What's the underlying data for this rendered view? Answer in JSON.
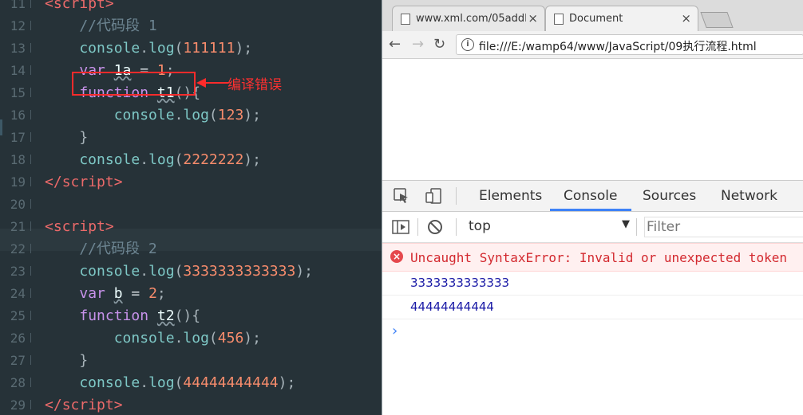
{
  "editor": {
    "lines": [
      {
        "n": "11",
        "tokens": [
          {
            "t": "<",
            "c": "tag"
          },
          {
            "t": "script",
            "c": "tag"
          },
          {
            "t": ">",
            "c": "tag"
          }
        ]
      },
      {
        "n": "12",
        "tokens": [
          {
            "t": "    //代码段 1",
            "c": "cmt"
          }
        ]
      },
      {
        "n": "13",
        "tokens": [
          {
            "t": "    console",
            "c": "fn"
          },
          {
            "t": ".",
            "c": "punc"
          },
          {
            "t": "log",
            "c": "fn"
          },
          {
            "t": "(",
            "c": "punc"
          },
          {
            "t": "111111",
            "c": "num"
          },
          {
            "t": ");",
            "c": "punc"
          }
        ]
      },
      {
        "n": "14",
        "tokens": [
          {
            "t": "    ",
            "c": "plain"
          },
          {
            "t": "var",
            "c": "kw"
          },
          {
            "t": " ",
            "c": "plain"
          },
          {
            "t": "1a",
            "c": "ref sq"
          },
          {
            "t": " = ",
            "c": "plain"
          },
          {
            "t": "1",
            "c": "num"
          },
          {
            "t": ";",
            "c": "punc"
          }
        ]
      },
      {
        "n": "15",
        "tokens": [
          {
            "t": "    ",
            "c": "plain"
          },
          {
            "t": "function",
            "c": "kw"
          },
          {
            "t": " ",
            "c": "plain"
          },
          {
            "t": "t1",
            "c": "ref sq"
          },
          {
            "t": "(){",
            "c": "punc"
          }
        ]
      },
      {
        "n": "16",
        "tokens": [
          {
            "t": "        console",
            "c": "fn"
          },
          {
            "t": ".",
            "c": "punc"
          },
          {
            "t": "log",
            "c": "fn"
          },
          {
            "t": "(",
            "c": "punc"
          },
          {
            "t": "123",
            "c": "num"
          },
          {
            "t": ");",
            "c": "punc"
          }
        ]
      },
      {
        "n": "17",
        "tokens": [
          {
            "t": "    }",
            "c": "punc"
          }
        ]
      },
      {
        "n": "18",
        "tokens": [
          {
            "t": "    console",
            "c": "fn"
          },
          {
            "t": ".",
            "c": "punc"
          },
          {
            "t": "log",
            "c": "fn"
          },
          {
            "t": "(",
            "c": "punc"
          },
          {
            "t": "2222222",
            "c": "num"
          },
          {
            "t": ");",
            "c": "punc"
          }
        ]
      },
      {
        "n": "19",
        "tokens": [
          {
            "t": "</",
            "c": "tag"
          },
          {
            "t": "script",
            "c": "tag"
          },
          {
            "t": ">",
            "c": "tag"
          }
        ]
      },
      {
        "n": "20",
        "tokens": []
      },
      {
        "n": "21",
        "tokens": [
          {
            "t": "<",
            "c": "tag"
          },
          {
            "t": "script",
            "c": "tag"
          },
          {
            "t": ">",
            "c": "tag"
          }
        ]
      },
      {
        "n": "22",
        "tokens": [
          {
            "t": "    //代码段 2",
            "c": "cmt"
          }
        ]
      },
      {
        "n": "23",
        "tokens": [
          {
            "t": "    console",
            "c": "fn"
          },
          {
            "t": ".",
            "c": "punc"
          },
          {
            "t": "log",
            "c": "fn"
          },
          {
            "t": "(",
            "c": "punc"
          },
          {
            "t": "3333333333333",
            "c": "num"
          },
          {
            "t": ");",
            "c": "punc"
          }
        ]
      },
      {
        "n": "24",
        "tokens": [
          {
            "t": "    ",
            "c": "plain"
          },
          {
            "t": "var",
            "c": "kw"
          },
          {
            "t": " ",
            "c": "plain"
          },
          {
            "t": "b",
            "c": "ref sq"
          },
          {
            "t": " = ",
            "c": "plain"
          },
          {
            "t": "2",
            "c": "num"
          },
          {
            "t": ";",
            "c": "punc"
          }
        ]
      },
      {
        "n": "25",
        "tokens": [
          {
            "t": "    ",
            "c": "plain"
          },
          {
            "t": "function",
            "c": "kw"
          },
          {
            "t": " ",
            "c": "plain"
          },
          {
            "t": "t2",
            "c": "ref sq"
          },
          {
            "t": "(){",
            "c": "punc"
          }
        ]
      },
      {
        "n": "26",
        "tokens": [
          {
            "t": "        console",
            "c": "fn"
          },
          {
            "t": ".",
            "c": "punc"
          },
          {
            "t": "log",
            "c": "fn"
          },
          {
            "t": "(",
            "c": "punc"
          },
          {
            "t": "456",
            "c": "num"
          },
          {
            "t": ");",
            "c": "punc"
          }
        ]
      },
      {
        "n": "27",
        "tokens": [
          {
            "t": "    }",
            "c": "punc"
          }
        ]
      },
      {
        "n": "28",
        "tokens": [
          {
            "t": "    console",
            "c": "fn"
          },
          {
            "t": ".",
            "c": "punc"
          },
          {
            "t": "log",
            "c": "fn"
          },
          {
            "t": "(",
            "c": "punc"
          },
          {
            "t": "44444444444",
            "c": "num"
          },
          {
            "t": ");",
            "c": "punc"
          }
        ]
      },
      {
        "n": "29",
        "tokens": [
          {
            "t": "</",
            "c": "tag"
          },
          {
            "t": "script",
            "c": "tag"
          },
          {
            "t": ">",
            "c": "tag"
          }
        ]
      }
    ],
    "annotation": "编译错误",
    "annotation_color": "#ff3030"
  },
  "browser": {
    "tabs": [
      {
        "title": "www.xml.com/05addEl",
        "close": "×"
      },
      {
        "title": "Document",
        "close": "×"
      }
    ],
    "nav": {
      "back": "←",
      "forward": "→",
      "reload": "↻"
    },
    "info_icon": "i",
    "url": "file:///E:/wamp64/www/JavaScript/09执行流程.html"
  },
  "devtools": {
    "tabs": [
      "Elements",
      "Console",
      "Sources",
      "Network"
    ],
    "active_tab": "Console",
    "accent": "#3e82f7",
    "context": "top",
    "context_caret": "▼",
    "filter_placeholder": "Filter",
    "messages": {
      "error_icon": "×",
      "error": "Uncaught SyntaxError: Invalid or unexpected token",
      "logs": [
        "3333333333333",
        "44444444444"
      ]
    },
    "prompt": "›"
  }
}
